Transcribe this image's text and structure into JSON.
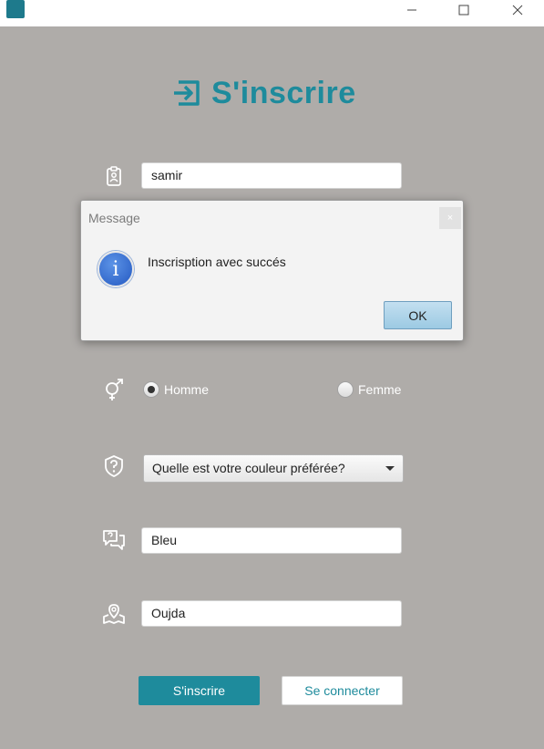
{
  "window": {
    "app_icon": "app-logo"
  },
  "header": {
    "title": "S'inscrire",
    "icon": "sign-in-icon",
    "color": "#1e8b9c"
  },
  "form": {
    "name_value": "samir",
    "gender": {
      "options": [
        {
          "label": "Homme",
          "selected": true
        },
        {
          "label": "Femme",
          "selected": false
        }
      ]
    },
    "question_selected": "Quelle est votre couleur préférée?",
    "answer_value": "Bleu",
    "city_value": "Oujda"
  },
  "buttons": {
    "register": "S'inscrire",
    "login": "Se connecter"
  },
  "dialog": {
    "title": "Message",
    "close": "×",
    "message": "Inscrisption avec succés",
    "info_glyph": "i",
    "ok": "OK"
  },
  "colors": {
    "background": "#afaca9",
    "accent": "#1e8b9c"
  }
}
